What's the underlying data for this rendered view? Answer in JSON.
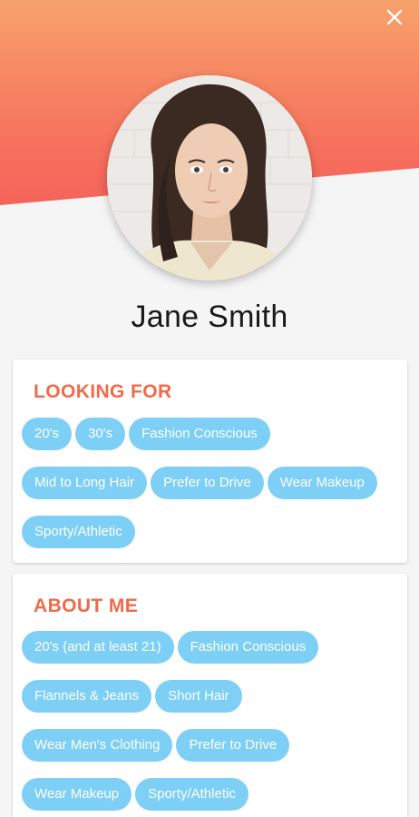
{
  "profile": {
    "name": "Jane Smith",
    "avatar_alt": "Profile photo"
  },
  "looking_for": {
    "title": "LOOKING FOR",
    "tags": [
      "20's",
      "30's",
      "Fashion Conscious",
      "Mid to Long Hair",
      "Prefer to Drive",
      "Wear Makeup",
      "Sporty/Athletic"
    ]
  },
  "about_me": {
    "title": "ABOUT ME",
    "tags": [
      "20's (and at least 21)",
      "Fashion Conscious",
      "Flannels & Jeans",
      "Short Hair",
      "Wear Men's Clothing",
      "Prefer to Drive",
      "Wear Makeup",
      "Sporty/Athletic"
    ]
  },
  "colors": {
    "header_gradient_top": "#f7a26c",
    "header_gradient_bottom": "#f4555a",
    "section_title": "#ef6a4c",
    "chip_background": "#7ecff5",
    "chip_text": "#ffffff"
  },
  "icons": {
    "close": "close-icon"
  }
}
